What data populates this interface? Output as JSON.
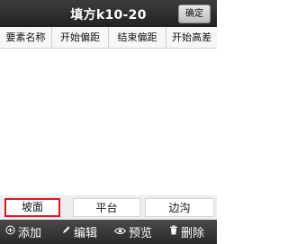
{
  "header": {
    "title": "填方k10-20",
    "confirm_label": "确定"
  },
  "table": {
    "columns": [
      "要素名称",
      "开始偏距",
      "结束偏距",
      "开始高差"
    ]
  },
  "segments": {
    "items": [
      "坡面",
      "平台",
      "边沟"
    ],
    "selected": "坡面",
    "selected_border_color": "#e0141e"
  },
  "toolbar": {
    "add_label": "添加",
    "edit_label": "编辑",
    "preview_label": "预览",
    "delete_label": "删除"
  }
}
